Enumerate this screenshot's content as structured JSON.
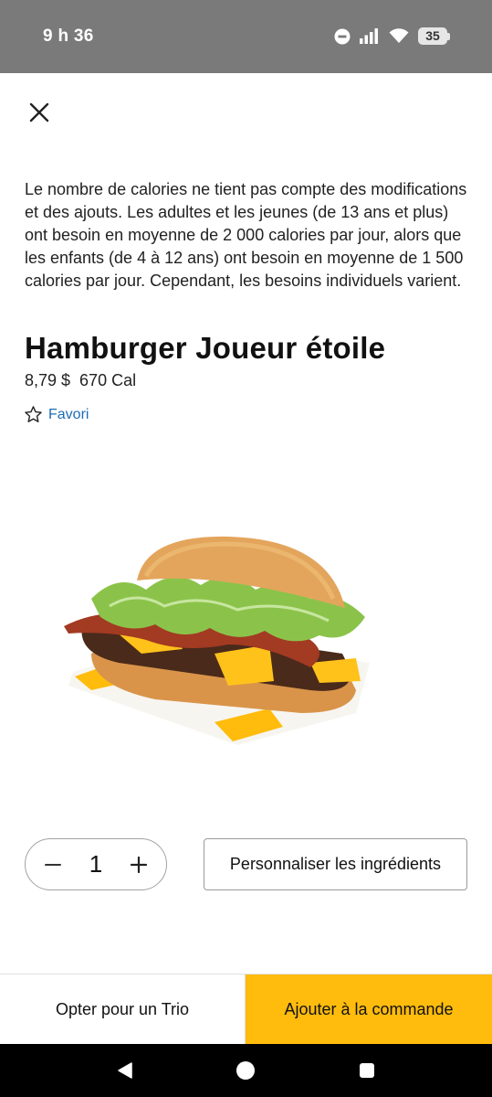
{
  "status_bar": {
    "time": "9 h 36",
    "battery": "35",
    "icons": [
      "do-not-disturb-icon",
      "signal-icon",
      "wifi-icon",
      "battery-icon"
    ]
  },
  "header": {
    "close_icon": "close-icon"
  },
  "calorie_note": "Le nombre de calories ne tient pas compte des modifications et des ajouts. Les adultes et les jeunes (de 13 ans et plus) ont besoin en moyenne de 2 000 calories par jour, alors que les enfants (de 4 à 12 ans) ont besoin en moyenne de 1 500 calories par jour. Cependant, les besoins individuels varient.",
  "product": {
    "title": "Hamburger Joueur étoile",
    "price": "8,79 $",
    "calories": "670 Cal",
    "favorite_label": "Favori"
  },
  "quantity": {
    "value": "1",
    "decrement_icon": "minus-icon",
    "increment_icon": "plus-icon"
  },
  "customize_label": "Personnaliser les ingrédients",
  "bottom": {
    "combo_label": "Opter pour un Trio",
    "add_label": "Ajouter à la commande"
  },
  "colors": {
    "accent": "#ffbc0d",
    "link": "#1c6db5",
    "status_bar": "#7a7a7a"
  },
  "nav_bar": {
    "icons": [
      "back-icon",
      "home-icon",
      "recents-icon"
    ]
  }
}
